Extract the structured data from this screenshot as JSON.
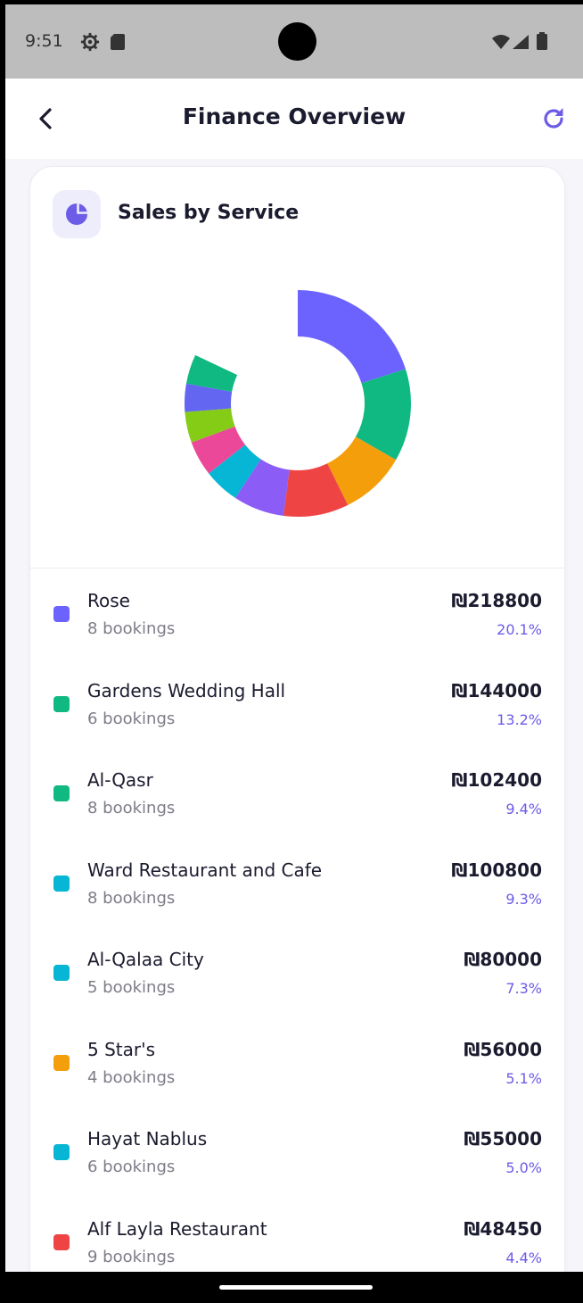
{
  "status_bar": {
    "time": "9:51"
  },
  "header": {
    "title": "Finance Overview"
  },
  "icons": {
    "back": "arrow-left-icon",
    "refresh": "refresh-icon",
    "card": "pie-chart-icon"
  },
  "colors": {
    "accent": "#6c5ce7",
    "text": "#1b1b2f",
    "muted": "#7d7d88"
  },
  "card": {
    "title": "Sales by Service"
  },
  "chart_data": {
    "type": "pie",
    "style": "donut",
    "slices": [
      {
        "label": "Rose",
        "percent": 20.1,
        "color": "#6c63ff"
      },
      {
        "label": "Gardens Wedding Hall",
        "percent": 13.2,
        "color": "#10b981"
      },
      {
        "label": "Al-Qasr",
        "percent": 9.4,
        "color": "#f59e0b"
      },
      {
        "label": "Ward Restaurant and Cafe",
        "percent": 9.3,
        "color": "#ef4444"
      },
      {
        "label": "Al-Qalaa City",
        "percent": 7.3,
        "color": "#8b5cf6"
      },
      {
        "label": "5 Star's",
        "percent": 5.1,
        "color": "#06b6d4"
      },
      {
        "label": "Hayat Nablus",
        "percent": 5.0,
        "color": "#ec4899"
      },
      {
        "label": "Alf Layla Restaurant",
        "percent": 4.4,
        "color": "#84cc16"
      },
      {
        "label": "",
        "percent": 4.0,
        "color": "#6366f1"
      },
      {
        "label": "",
        "percent": 4.2,
        "color": "#10b981"
      }
    ]
  },
  "services": [
    {
      "name": "Rose",
      "bookings": "8 bookings",
      "amount": "₪218800",
      "percent": "20.1%",
      "color": "#6c63ff"
    },
    {
      "name": "Gardens Wedding Hall",
      "bookings": "6 bookings",
      "amount": "₪144000",
      "percent": "13.2%",
      "color": "#10b981"
    },
    {
      "name": "Al-Qasr",
      "bookings": "8 bookings",
      "amount": "₪102400",
      "percent": "9.4%",
      "color": "#10b981"
    },
    {
      "name": "Ward Restaurant and Cafe",
      "bookings": "8 bookings",
      "amount": "₪100800",
      "percent": "9.3%",
      "color": "#06b6d4"
    },
    {
      "name": "Al-Qalaa City",
      "bookings": "5 bookings",
      "amount": "₪80000",
      "percent": "7.3%",
      "color": "#06b6d4"
    },
    {
      "name": "5 Star's",
      "bookings": "4 bookings",
      "amount": "₪56000",
      "percent": "5.1%",
      "color": "#f59e0b"
    },
    {
      "name": "Hayat Nablus",
      "bookings": "6 bookings",
      "amount": "₪55000",
      "percent": "5.0%",
      "color": "#06b6d4"
    },
    {
      "name": "Alf Layla Restaurant",
      "bookings": "9 bookings",
      "amount": "₪48450",
      "percent": "4.4%",
      "color": "#ef4444"
    }
  ]
}
